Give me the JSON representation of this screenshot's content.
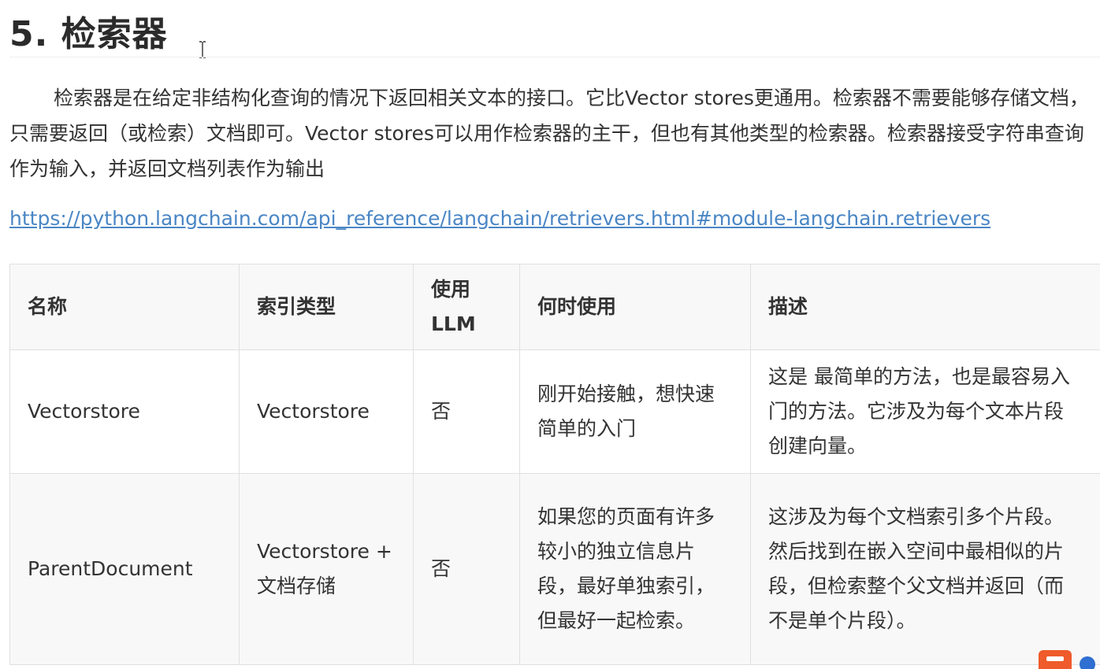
{
  "heading": "5. 检索器",
  "paragraph": "检索器是在给定非结构化查询的情况下返回相关文本的接口。它比Vector stores更通用。检索器不需要能够存储文档，只需要返回（或检索）文档即可。Vector stores可以用作检索器的主干，但也有其他类型的检索器。检索器接受字符串查询作为输入，并返回文档列表作为输出",
  "link": "https://python.langchain.com/api_reference/langchain/retrievers.html#module-langchain.retrievers",
  "table": {
    "headers": [
      "名称",
      "索引类型",
      "使用LLM",
      "何时使用",
      "描述"
    ],
    "rows": [
      {
        "name": "Vectorstore",
        "index_type": "Vectorstore",
        "uses_llm": "否",
        "when_to_use": "刚开始接触，想快速简单的入门",
        "description": "这是 最简单的方法，也是最容易入门的方法。它涉及为每个文本片段创建向量。"
      },
      {
        "name": "ParentDocument",
        "index_type": "Vectorstore + 文档存储",
        "uses_llm": "否",
        "when_to_use": "如果您的页面有许多较小的独立信息片段，最好单独索引，但最好一起检索。",
        "description": "这涉及为每个文档索引多个片段。然后找到在嵌入空间中最相似的片段，但检索整个父文档并返回（而不是单个片段）。"
      }
    ]
  },
  "icons": {
    "cursor": "text-cursor-icon",
    "corner_badge": "app-badge-icon",
    "corner_dot": "assistant-dot-icon"
  },
  "colors": {
    "link": "#4a86c5",
    "header_bg": "#f8f8f8",
    "border": "#e0e0e0",
    "badge": "#ef5b2a",
    "dot": "#2e6fd1"
  }
}
